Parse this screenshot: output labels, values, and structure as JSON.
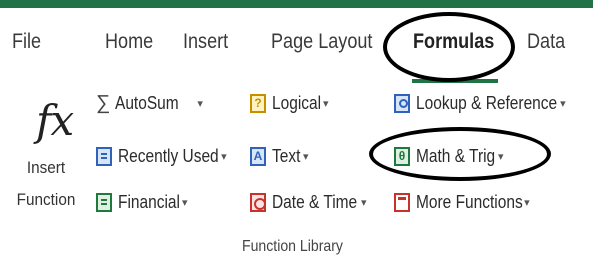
{
  "accent": "#217346",
  "ribbon": {
    "tabs": [
      {
        "label": "File"
      },
      {
        "label": "Home"
      },
      {
        "label": "Insert"
      },
      {
        "label": "Page Layout"
      },
      {
        "label": "Formulas",
        "active": true
      },
      {
        "label": "Data"
      }
    ]
  },
  "function_library": {
    "insert_function": {
      "symbol": "fx",
      "line1": "Insert",
      "line2": "Function"
    },
    "commands": {
      "autosum": {
        "label": "AutoSum",
        "icon": "sigma-icon"
      },
      "recently_used": {
        "label": "Recently Used",
        "icon": "book-icon"
      },
      "financial": {
        "label": "Financial",
        "icon": "book-icon"
      },
      "logical": {
        "label": "Logical",
        "icon": "question-icon"
      },
      "text": {
        "label": "Text",
        "icon": "text-a-icon"
      },
      "date_time": {
        "label": "Date & Time",
        "icon": "clock-icon"
      },
      "lookup_reference": {
        "label": "Lookup & Reference",
        "icon": "magnifier-icon"
      },
      "math_trig": {
        "label": "Math & Trig",
        "icon": "theta-icon"
      },
      "more_functions": {
        "label": "More Functions",
        "icon": "more-functions-icon"
      }
    },
    "group_label": "Function Library",
    "dropdown_caret": "▾"
  }
}
